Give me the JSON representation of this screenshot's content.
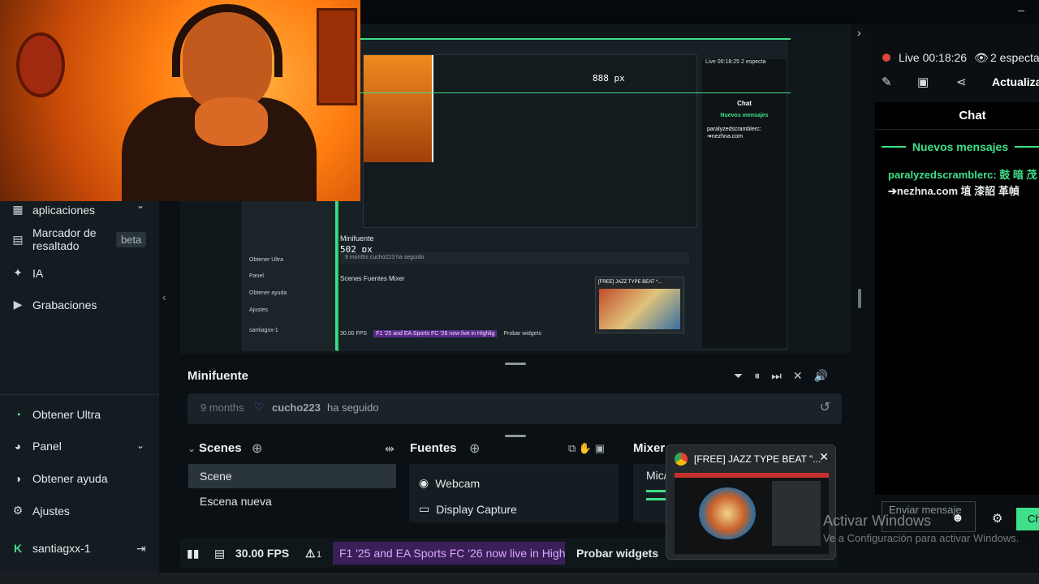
{
  "window": {
    "minimize_label": "–"
  },
  "sidebar": {
    "items": [
      {
        "label": "aplicaciones",
        "icon": "apps-icon"
      },
      {
        "label": "Marcador de resaltado",
        "badge": "beta",
        "icon": "highlight-icon"
      },
      {
        "label": "IA",
        "icon": "sparkle-icon"
      },
      {
        "label": "Grabaciones",
        "icon": "play-icon"
      }
    ],
    "bottom_items": [
      {
        "label": "Obtener Ultra",
        "icon": "ultra-icon"
      },
      {
        "label": "Panel",
        "icon": "panel-icon"
      },
      {
        "label": "Obtener ayuda",
        "icon": "help-icon"
      },
      {
        "label": "Ajustes",
        "icon": "gear-icon"
      }
    ],
    "user": {
      "name": "santiagxx-1",
      "icon": "kick-icon"
    }
  },
  "preview": {
    "inner_sidebar": [
      "Obtener Ultra",
      "Panel",
      "Obtener ayuda",
      "Ajustes",
      "santiagxx-1"
    ],
    "inner_minifuente": "Minifuente",
    "size_readout_h": "502 px",
    "size_readout_w": "888 px",
    "inner_follow": "9 months   cucho223  ha seguido",
    "inner_scenes": "Scenes    Fuentes    Mixer",
    "inner_fps": "30.00 FPS",
    "inner_ticker": "F1 '25 and EA Sports FC '26 now live in Highlig",
    "inner_widgets": "Probar widgets",
    "inner_live": "Live 00:18:25  2 especta",
    "inner_chat": "Chat",
    "inner_new": "Nuevos mensajes",
    "inner_msg": "paralyzedscramblerc:\n➔nezhna.com",
    "inner_popup": "[FREE] JAZZ TYPE BEAT *..."
  },
  "minifuente": {
    "title": "Minifuente",
    "activity": {
      "time": "9 months",
      "user": "cucho223",
      "action": "ha seguido"
    }
  },
  "scenes": {
    "title": "Scenes",
    "items": [
      "Scene",
      "Escena nueva"
    ],
    "active_index": 0
  },
  "fuentes": {
    "title": "Fuentes",
    "items": [
      {
        "label": "Webcam",
        "icon": "webcam-icon"
      },
      {
        "label": "Display Capture",
        "icon": "monitor-icon"
      }
    ]
  },
  "mixer": {
    "title": "Mixer",
    "label": "Mic/A"
  },
  "statusbar": {
    "fps": "30.00 FPS",
    "alerts": "1",
    "ticker": "F1 '25 and EA Sports FC '26 now live in Highlig",
    "test_widgets": "Probar widgets"
  },
  "stream": {
    "live_time": "Live 00:18:26",
    "viewers": "2 especta",
    "update_label": "Actualiza"
  },
  "chat": {
    "title": "Chat",
    "new_messages": "Nuevos mensajes",
    "messages": [
      {
        "user": "paralyzedscramblerc: 鼓 暗 茂",
        "text": "➔nezhna.com 埴 漆詔 革幀"
      }
    ],
    "input_placeholder": "Enviar mensaje",
    "send_label": "Ch"
  },
  "windows_watermark": {
    "line1": "Activar Windows",
    "line2": "Ve a Configuración para activar Windows."
  },
  "yt_popup": {
    "title": "[FREE] JAZZ TYPE BEAT \"..."
  }
}
